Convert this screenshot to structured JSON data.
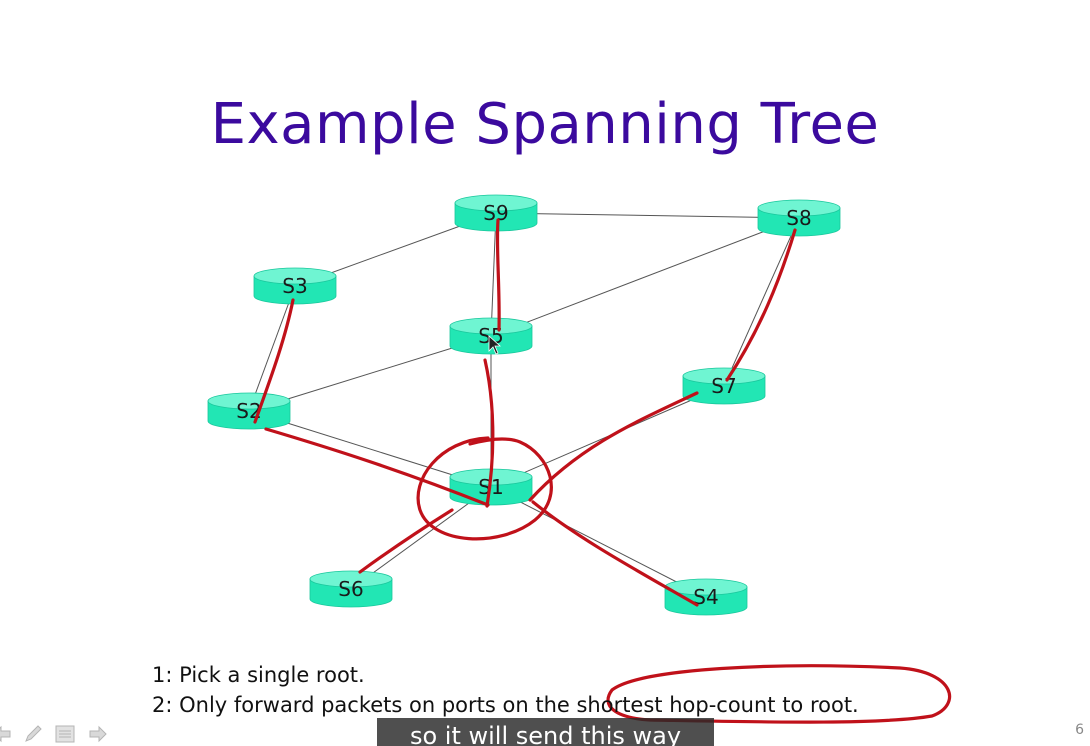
{
  "slide": {
    "title": "Example Spanning Tree",
    "bullets": [
      "1: Pick a single root.",
      "2: Only forward packets on ports on the shortest hop-count to root."
    ],
    "page_number": "6"
  },
  "video": {
    "caption": "so it will send this way"
  },
  "diagram": {
    "node_color": "#22e6b4",
    "node_top_color": "#6ff5d2",
    "link_color": "#555555",
    "annotation_color": "#c0111a",
    "nodes": [
      {
        "id": "S9",
        "label": "S9"
      },
      {
        "id": "S8",
        "label": "S8"
      },
      {
        "id": "S3",
        "label": "S3"
      },
      {
        "id": "S5",
        "label": "S5"
      },
      {
        "id": "S7",
        "label": "S7"
      },
      {
        "id": "S2",
        "label": "S2"
      },
      {
        "id": "S1",
        "label": "S1"
      },
      {
        "id": "S6",
        "label": "S6"
      },
      {
        "id": "S4",
        "label": "S4"
      }
    ],
    "links": [
      [
        "S9",
        "S8"
      ],
      [
        "S9",
        "S3"
      ],
      [
        "S9",
        "S5"
      ],
      [
        "S8",
        "S5"
      ],
      [
        "S8",
        "S7"
      ],
      [
        "S3",
        "S2"
      ],
      [
        "S5",
        "S2"
      ],
      [
        "S5",
        "S1"
      ],
      [
        "S2",
        "S1"
      ],
      [
        "S1",
        "S7"
      ],
      [
        "S1",
        "S6"
      ],
      [
        "S1",
        "S4"
      ]
    ],
    "tree_links": [
      [
        "S9",
        "S5"
      ],
      [
        "S5",
        "S1"
      ],
      [
        "S8",
        "S7"
      ],
      [
        "S7",
        "S1"
      ],
      [
        "S3",
        "S2"
      ],
      [
        "S2",
        "S1"
      ],
      [
        "S1",
        "S6"
      ],
      [
        "S1",
        "S4"
      ]
    ]
  },
  "toolbar": {
    "icons": [
      "prev-arrow-icon",
      "pen-icon",
      "menu-icon",
      "next-arrow-icon"
    ]
  }
}
